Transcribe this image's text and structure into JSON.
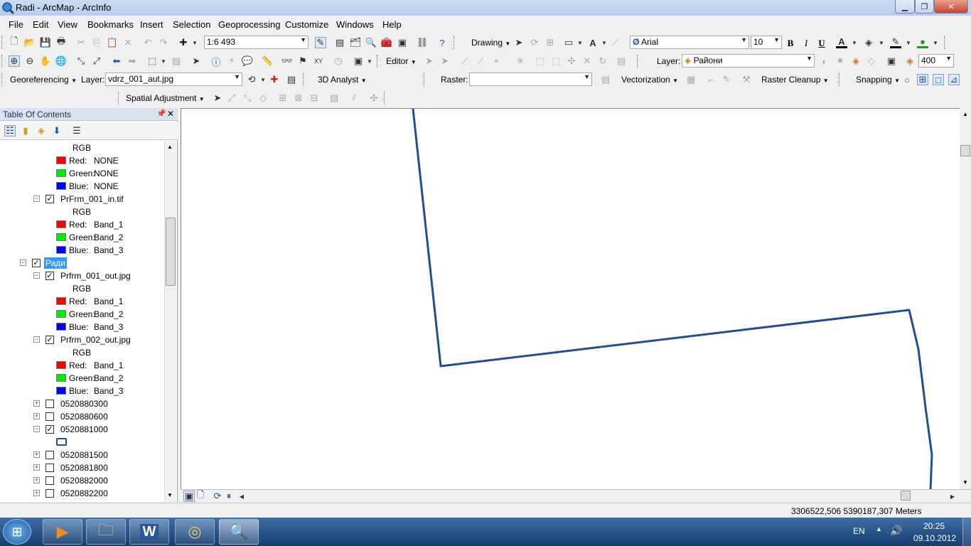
{
  "window": {
    "title": "Radi - ArcMap - ArcInfo"
  },
  "menu": [
    "File",
    "Edit",
    "View",
    "Bookmarks",
    "Insert",
    "Selection",
    "Geoprocessing",
    "Customize",
    "Windows",
    "Help"
  ],
  "toolbar1": {
    "scale": "1:6 493",
    "drawing_label": "Drawing",
    "font_name": "Arial",
    "font_size": "10",
    "bold": "B",
    "italic": "I",
    "underline": "U",
    "text_a": "A"
  },
  "toolbar2": {
    "editor_label": "Editor",
    "layer_label": "Layer:",
    "layer_value": "Райони",
    "zoom_value": "400"
  },
  "toolbar3": {
    "georef_label": "Georeferencing",
    "layer_label": "Layer:",
    "layer_value": "vdrz_001_aut.jpg",
    "analyst_label": "3D Analyst",
    "raster_label": "Raster:",
    "vectorization_label": "Vectorization",
    "raster_cleanup_label": "Raster Cleanup",
    "snapping_label": "Snapping"
  },
  "toolbar4": {
    "spatial_adjustment_label": "Spatial Adjustment"
  },
  "toc": {
    "title": "Table Of Contents",
    "rows": [
      {
        "type": "text",
        "indent": 2,
        "label": "RGB"
      },
      {
        "type": "band",
        "color": "#ff0000",
        "label": "Red:",
        "value": "NONE"
      },
      {
        "type": "band",
        "color": "#00ee00",
        "label": "Green:",
        "value": "NONE"
      },
      {
        "type": "band",
        "color": "#0000ff",
        "label": "Blue:",
        "value": "NONE"
      },
      {
        "type": "layer",
        "checked": true,
        "expanded": true,
        "label": "PrFrm_001_in.tif"
      },
      {
        "type": "text",
        "indent": 2,
        "label": "RGB"
      },
      {
        "type": "band",
        "color": "#ff0000",
        "label": "Red:",
        "value": "Band_1"
      },
      {
        "type": "band",
        "color": "#00ee00",
        "label": "Green:",
        "value": "Band_2"
      },
      {
        "type": "band",
        "color": "#0000ff",
        "label": "Blue:",
        "value": "Band_3"
      },
      {
        "type": "group",
        "checked": true,
        "expanded": true,
        "label": "Ради",
        "selected": true
      },
      {
        "type": "layer",
        "checked": true,
        "expanded": true,
        "label": "Prfrm_001_out.jpg"
      },
      {
        "type": "text",
        "indent": 2,
        "label": "RGB"
      },
      {
        "type": "band",
        "color": "#ff0000",
        "label": "Red:",
        "value": "Band_1"
      },
      {
        "type": "band",
        "color": "#00ee00",
        "label": "Green:",
        "value": "Band_2"
      },
      {
        "type": "band",
        "color": "#0000ff",
        "label": "Blue:",
        "value": "Band_3"
      },
      {
        "type": "layer",
        "checked": true,
        "expanded": true,
        "label": "Prfrm_002_out.jpg"
      },
      {
        "type": "text",
        "indent": 2,
        "label": "RGB"
      },
      {
        "type": "band",
        "color": "#ff0000",
        "label": "Red:",
        "value": "Band_1"
      },
      {
        "type": "band",
        "color": "#00ee00",
        "label": "Green:",
        "value": "Band_2"
      },
      {
        "type": "band",
        "color": "#0000ff",
        "label": "Blue:",
        "value": "Band_3"
      },
      {
        "type": "layer",
        "checked": false,
        "expanded": false,
        "label": "0520880300"
      },
      {
        "type": "layer",
        "checked": false,
        "expanded": false,
        "label": "0520880600"
      },
      {
        "type": "layer",
        "checked": true,
        "expanded": true,
        "label": "0520881000"
      },
      {
        "type": "polysym"
      },
      {
        "type": "layer",
        "checked": false,
        "expanded": false,
        "label": "0520881500"
      },
      {
        "type": "layer",
        "checked": false,
        "expanded": false,
        "label": "0520881800"
      },
      {
        "type": "layer",
        "checked": false,
        "expanded": false,
        "label": "0520882000"
      },
      {
        "type": "layer",
        "checked": false,
        "expanded": false,
        "label": "0520882200"
      }
    ]
  },
  "status": {
    "coordinates": "3306522,506  5390187,307 Meters"
  },
  "tray": {
    "lang": "EN",
    "time": "20:25",
    "date": "09.10.2012"
  },
  "colors": {
    "polyline": "#1f4e96",
    "selection": "#3399ff"
  }
}
